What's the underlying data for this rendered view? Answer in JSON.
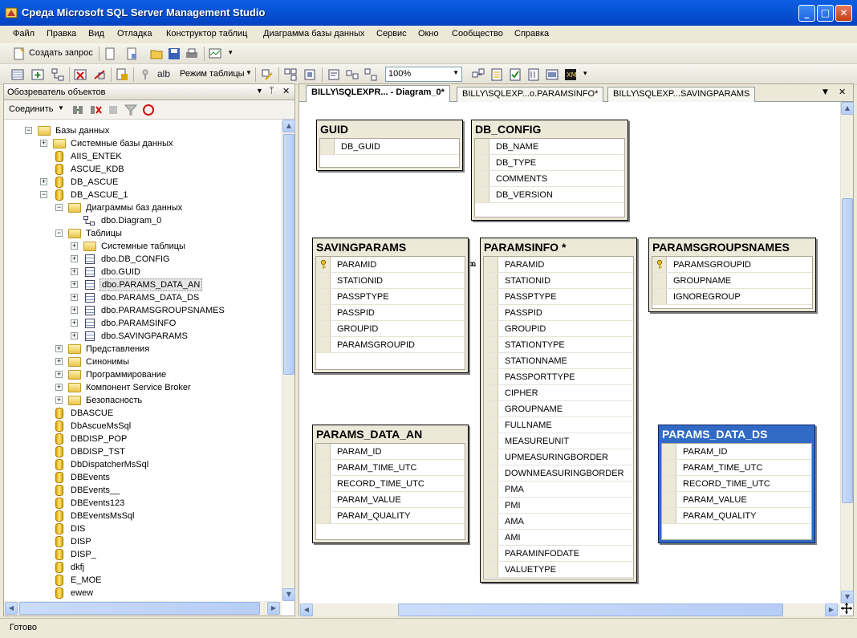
{
  "window": {
    "title": "Среда Microsoft SQL Server Management Studio"
  },
  "menu": [
    "Файл",
    "Правка",
    "Вид",
    "Отладка",
    "Конструктор таблиц",
    "Диаграмма базы данных",
    "Сервис",
    "Окно",
    "Сообщество",
    "Справка"
  ],
  "toolbar1": {
    "new_query": "Создать запрос"
  },
  "toolbar2": {
    "table_mode": "Режим таблицы",
    "zoom": "100%"
  },
  "object_explorer": {
    "title": "Обозреватель объектов",
    "connect": "Соединить"
  },
  "tree": [
    {
      "label": "Базы данных",
      "level": 0,
      "exp": "−",
      "icon": "folder"
    },
    {
      "label": "Системные базы данных",
      "level": 1,
      "exp": "+",
      "icon": "folder"
    },
    {
      "label": "AIIS_ENTEK",
      "level": 1,
      "exp": "",
      "icon": "db"
    },
    {
      "label": "ASCUE_KDB",
      "level": 1,
      "exp": "",
      "icon": "db"
    },
    {
      "label": "DB_ASCUE",
      "level": 1,
      "exp": "+",
      "icon": "db"
    },
    {
      "label": "DB_ASCUE_1",
      "level": 1,
      "exp": "−",
      "icon": "db"
    },
    {
      "label": "Диаграммы баз данных",
      "level": 2,
      "exp": "−",
      "icon": "folder"
    },
    {
      "label": "dbo.Diagram_0",
      "level": 3,
      "exp": "",
      "icon": "diagram"
    },
    {
      "label": "Таблицы",
      "level": 2,
      "exp": "−",
      "icon": "folder"
    },
    {
      "label": "Системные таблицы",
      "level": 3,
      "exp": "+",
      "icon": "folder"
    },
    {
      "label": "dbo.DB_CONFIG",
      "level": 3,
      "exp": "+",
      "icon": "table"
    },
    {
      "label": "dbo.GUID",
      "level": 3,
      "exp": "+",
      "icon": "table"
    },
    {
      "label": "dbo.PARAMS_DATA_AN",
      "level": 3,
      "exp": "+",
      "icon": "table",
      "selected": true
    },
    {
      "label": "dbo.PARAMS_DATA_DS",
      "level": 3,
      "exp": "+",
      "icon": "table"
    },
    {
      "label": "dbo.PARAMSGROUPSNAMES",
      "level": 3,
      "exp": "+",
      "icon": "table"
    },
    {
      "label": "dbo.PARAMSINFO",
      "level": 3,
      "exp": "+",
      "icon": "table"
    },
    {
      "label": "dbo.SAVINGPARAMS",
      "level": 3,
      "exp": "+",
      "icon": "table"
    },
    {
      "label": "Представления",
      "level": 2,
      "exp": "+",
      "icon": "folder"
    },
    {
      "label": "Синонимы",
      "level": 2,
      "exp": "+",
      "icon": "folder"
    },
    {
      "label": "Программирование",
      "level": 2,
      "exp": "+",
      "icon": "folder"
    },
    {
      "label": "Компонент Service Broker",
      "level": 2,
      "exp": "+",
      "icon": "folder"
    },
    {
      "label": "Безопасность",
      "level": 2,
      "exp": "+",
      "icon": "folder"
    },
    {
      "label": "DBASCUE",
      "level": 1,
      "exp": "",
      "icon": "db"
    },
    {
      "label": "DbAscueMsSql",
      "level": 1,
      "exp": "",
      "icon": "db"
    },
    {
      "label": "DBDISP_POP",
      "level": 1,
      "exp": "",
      "icon": "db"
    },
    {
      "label": "DBDISP_TST",
      "level": 1,
      "exp": "",
      "icon": "db"
    },
    {
      "label": "DbDispatcherMsSql",
      "level": 1,
      "exp": "",
      "icon": "db"
    },
    {
      "label": "DBEvents",
      "level": 1,
      "exp": "",
      "icon": "db"
    },
    {
      "label": "DBEvents__",
      "level": 1,
      "exp": "",
      "icon": "db"
    },
    {
      "label": "DBEvents123",
      "level": 1,
      "exp": "",
      "icon": "db"
    },
    {
      "label": "DBEventsMsSql",
      "level": 1,
      "exp": "",
      "icon": "db"
    },
    {
      "label": "DIS",
      "level": 1,
      "exp": "",
      "icon": "db"
    },
    {
      "label": "DISP",
      "level": 1,
      "exp": "",
      "icon": "db"
    },
    {
      "label": "DISP_",
      "level": 1,
      "exp": "",
      "icon": "db"
    },
    {
      "label": "dkfj",
      "level": 1,
      "exp": "",
      "icon": "db"
    },
    {
      "label": "E_MOE",
      "level": 1,
      "exp": "",
      "icon": "db"
    },
    {
      "label": "ewew",
      "level": 1,
      "exp": "",
      "icon": "db"
    }
  ],
  "tabs": [
    {
      "label": "BILLY\\SQLEXPR... - Diagram_0*",
      "active": true
    },
    {
      "label": "BILLY\\SQLEXP...o.PARAMSINFO*",
      "active": false
    },
    {
      "label": "BILLY\\SQLEXP...SAVINGPARAMS",
      "active": false
    }
  ],
  "diagram": {
    "tables": [
      {
        "name": "GUID",
        "columns": [
          "DB_GUID"
        ],
        "keys": []
      },
      {
        "name": "DB_CONFIG",
        "columns": [
          "DB_NAME",
          "DB_TYPE",
          "COMMENTS",
          "DB_VERSION"
        ],
        "keys": []
      },
      {
        "name": "SAVINGPARAMS",
        "columns": [
          "PARAMID",
          "STATIONID",
          "PASSPTYPE",
          "PASSPID",
          "GROUPID",
          "PARAMSGROUPID"
        ],
        "keys": [
          0
        ]
      },
      {
        "name": "PARAMSINFO *",
        "columns": [
          "PARAMID",
          "STATIONID",
          "PASSPTYPE",
          "PASSPID",
          "GROUPID",
          "STATIONTYPE",
          "STATIONNAME",
          "PASSPORTTYPE",
          "CIPHER",
          "GROUPNAME",
          "FULLNAME",
          "MEASUREUNIT",
          "UPMEASURINGBORDER",
          "DOWNMEASURINGBORDER",
          "PMA",
          "PMI",
          "AMA",
          "AMI",
          "PARAMINFODATE",
          "VALUETYPE"
        ],
        "keys": []
      },
      {
        "name": "PARAMSGROUPSNAMES",
        "columns": [
          "PARAMSGROUPID",
          "GROUPNAME",
          "IGNOREGROUP"
        ],
        "keys": [
          0
        ]
      },
      {
        "name": "PARAMS_DATA_AN",
        "columns": [
          "PARAM_ID",
          "PARAM_TIME_UTC",
          "RECORD_TIME_UTC",
          "PARAM_VALUE",
          "PARAM_QUALITY"
        ],
        "keys": []
      },
      {
        "name": "PARAMS_DATA_DS",
        "columns": [
          "PARAM_ID",
          "PARAM_TIME_UTC",
          "RECORD_TIME_UTC",
          "PARAM_VALUE",
          "PARAM_QUALITY"
        ],
        "keys": [],
        "selected": true
      }
    ]
  },
  "status": {
    "text": "Готово"
  },
  "colors": {
    "titlebar": "#0a5ee0",
    "selection": "#316ac5",
    "toolbar": "#ece9d8"
  }
}
